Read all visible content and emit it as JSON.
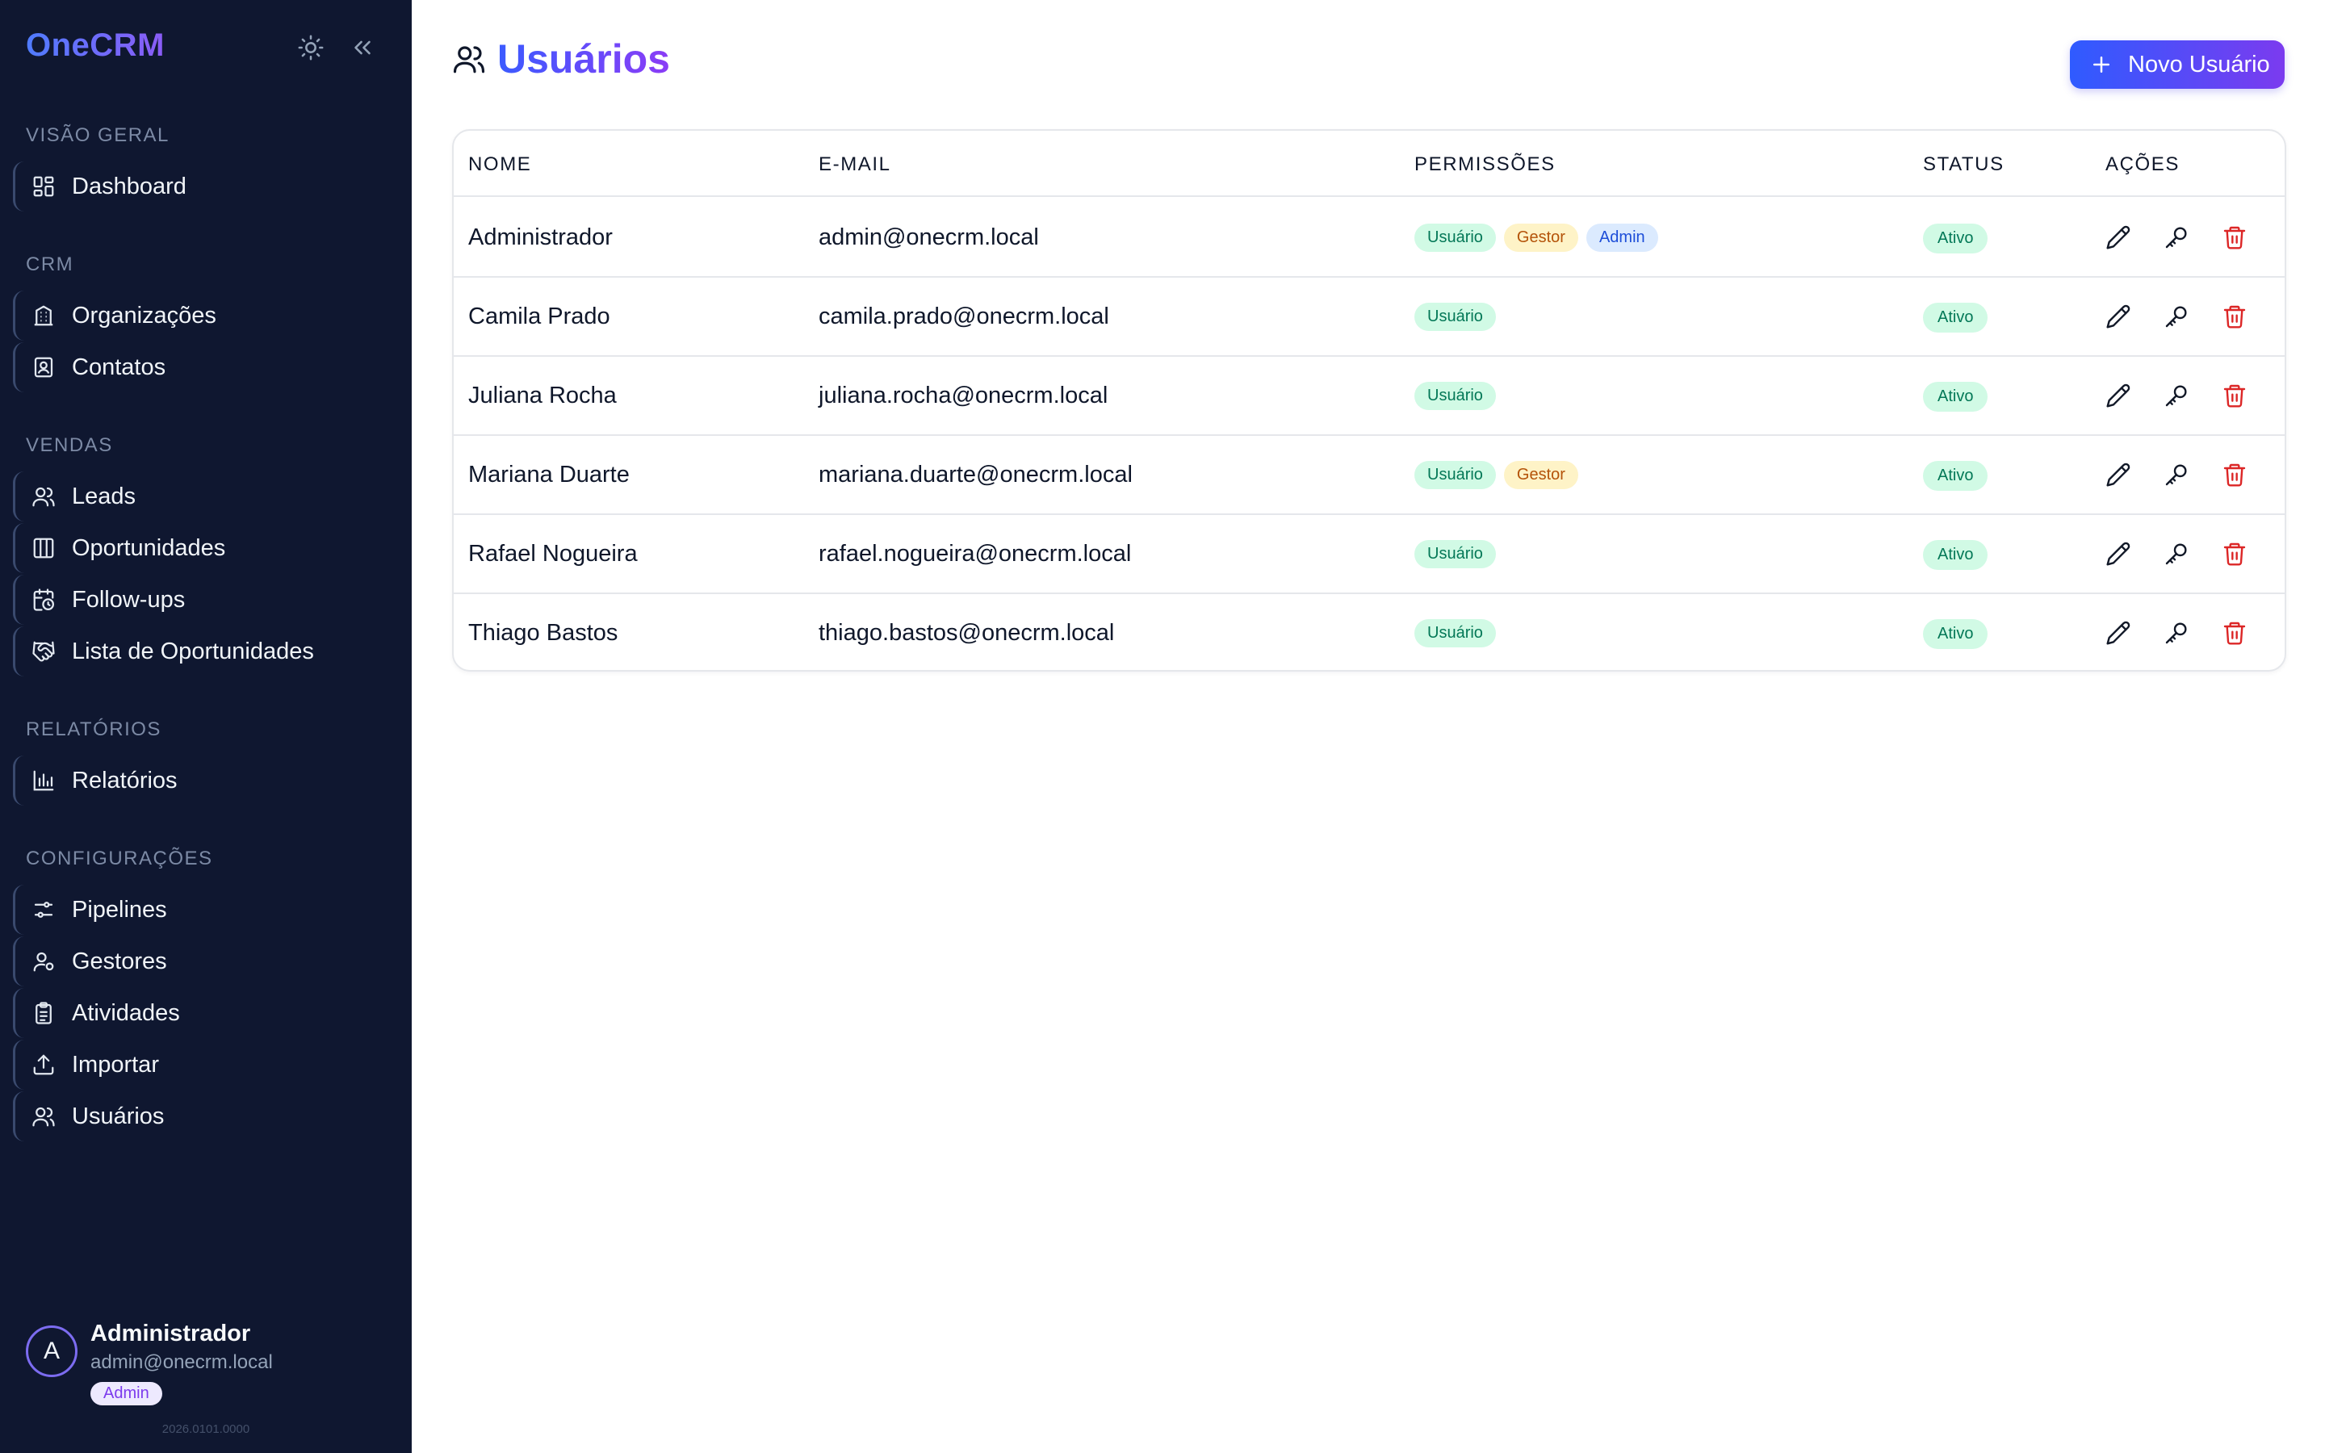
{
  "app": {
    "brand": "OneCRM"
  },
  "icons": {
    "theme_toggle": "sun-icon",
    "collapse": "chevrons-left-icon"
  },
  "sidebar": {
    "sections": [
      {
        "title": "VISÃO GERAL",
        "items": [
          {
            "label": "Dashboard",
            "icon": "layout-dashboard-icon"
          }
        ]
      },
      {
        "title": "CRM",
        "items": [
          {
            "label": "Organizações",
            "icon": "building-icon"
          },
          {
            "label": "Contatos",
            "icon": "contact-icon"
          }
        ]
      },
      {
        "title": "VENDAS",
        "items": [
          {
            "label": "Leads",
            "icon": "users-icon"
          },
          {
            "label": "Oportunidades",
            "icon": "columns-icon"
          },
          {
            "label": "Follow-ups",
            "icon": "calendar-clock-icon"
          },
          {
            "label": "Lista de Oportunidades",
            "icon": "handshake-icon"
          }
        ]
      },
      {
        "title": "RELATÓRIOS",
        "items": [
          {
            "label": "Relatórios",
            "icon": "bar-chart-icon"
          }
        ]
      },
      {
        "title": "CONFIGURAÇÕES",
        "items": [
          {
            "label": "Pipelines",
            "icon": "sliders-icon"
          },
          {
            "label": "Gestores",
            "icon": "user-cog-icon"
          },
          {
            "label": "Atividades",
            "icon": "clipboard-list-icon"
          },
          {
            "label": "Importar",
            "icon": "upload-icon"
          },
          {
            "label": "Usuários",
            "icon": "users-icon"
          }
        ]
      }
    ],
    "user": {
      "initial": "A",
      "name": "Administrador",
      "email": "admin@onecrm.local",
      "role": "Admin"
    },
    "version": "2026.0101.0000"
  },
  "page": {
    "title": "Usuários",
    "new_button": "Novo Usuário",
    "table": {
      "headers": {
        "name": "NOME",
        "email": "E-MAIL",
        "permissions": "PERMISSÕES",
        "status": "STATUS",
        "actions": "AÇÕES"
      },
      "rows": [
        {
          "name": "Administrador",
          "email": "admin@onecrm.local",
          "permissions": [
            "Usuário",
            "Gestor",
            "Admin"
          ],
          "status": "Ativo"
        },
        {
          "name": "Camila Prado",
          "email": "camila.prado@onecrm.local",
          "permissions": [
            "Usuário"
          ],
          "status": "Ativo"
        },
        {
          "name": "Juliana Rocha",
          "email": "juliana.rocha@onecrm.local",
          "permissions": [
            "Usuário"
          ],
          "status": "Ativo"
        },
        {
          "name": "Mariana Duarte",
          "email": "mariana.duarte@onecrm.local",
          "permissions": [
            "Usuário",
            "Gestor"
          ],
          "status": "Ativo"
        },
        {
          "name": "Rafael Nogueira",
          "email": "rafael.nogueira@onecrm.local",
          "permissions": [
            "Usuário"
          ],
          "status": "Ativo"
        },
        {
          "name": "Thiago Bastos",
          "email": "thiago.bastos@onecrm.local",
          "permissions": [
            "Usuário"
          ],
          "status": "Ativo"
        }
      ]
    }
  },
  "colors": {
    "sidebar_bg": "#0f1730",
    "accent_start": "#2f5bff",
    "accent_end": "#7b3bef",
    "badge_usuario": "#d1fae5",
    "badge_gestor": "#fef3c7",
    "badge_admin": "#dbeafe",
    "delete": "#dc2626"
  }
}
